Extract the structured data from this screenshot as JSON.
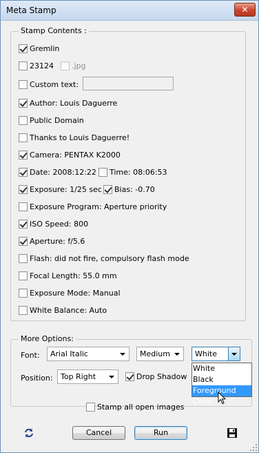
{
  "window": {
    "title": "Meta Stamp",
    "close_label": "✕"
  },
  "stamp_contents": {
    "legend": "Stamp Contents :",
    "gremlin": {
      "label": "Gremlin",
      "checked": true
    },
    "number": {
      "label": "23124",
      "checked": false
    },
    "jpg": {
      "label": ".jpg",
      "checked": false,
      "disabled": true
    },
    "custom_text": {
      "label": "Custom text:",
      "checked": false,
      "value": ""
    },
    "author": {
      "label": "Author: Louis Daguerre",
      "checked": true
    },
    "public_domain": {
      "label": "Public Domain",
      "checked": false
    },
    "thanks": {
      "label": "Thanks to Louis Daguerre!",
      "checked": false
    },
    "camera": {
      "label": "Camera: PENTAX K2000",
      "checked": true
    },
    "date": {
      "label": "Date: 2008:12:22",
      "checked": true
    },
    "time": {
      "label": "Time: 08:06:53",
      "checked": false
    },
    "exposure": {
      "label": "Exposure: 1/25 sec",
      "checked": true
    },
    "bias": {
      "label": "Bias: -0.70",
      "checked": true
    },
    "exposure_program": {
      "label": "Exposure Program: Aperture priority",
      "checked": false
    },
    "iso": {
      "label": "ISO Speed: 800",
      "checked": true
    },
    "aperture": {
      "label": "Aperture: f/5.6",
      "checked": true
    },
    "flash": {
      "label": "Flash: did not fire, compulsory flash mode",
      "checked": false
    },
    "focal_length": {
      "label": "Focal Length: 55.0 mm",
      "checked": false
    },
    "exposure_mode": {
      "label": "Exposure Mode: Manual",
      "checked": false
    },
    "white_balance": {
      "label": "White Balance: Auto",
      "checked": false
    }
  },
  "more_options": {
    "legend": "More Options:",
    "font_label": "Font:",
    "font_value": "Arial Italic",
    "size_value": "Medium",
    "color_value": "White",
    "color_options": [
      "White",
      "Black",
      "Foreground Color"
    ],
    "color_highlighted": "Foreground Color",
    "position_label": "Position:",
    "position_value": "Top Right",
    "drop_shadow": {
      "label": "Drop Shadow",
      "checked": true
    }
  },
  "stamp_all": {
    "label": "Stamp all open images",
    "checked": false
  },
  "buttons": {
    "cancel": "Cancel",
    "run": "Run"
  },
  "icons": {
    "refresh": "refresh-icon",
    "save": "save-icon"
  }
}
